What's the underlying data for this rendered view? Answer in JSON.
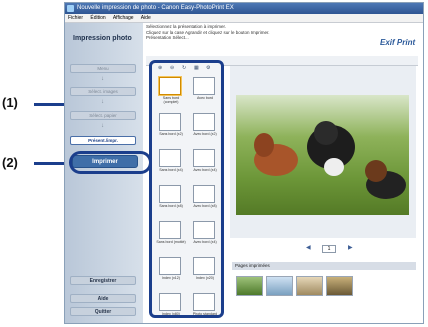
{
  "window": {
    "title": "Nouvelle impression de photo - Canon Easy-PhotoPrint EX",
    "menu": [
      "Fichier",
      "Édition",
      "Affichage",
      "Aide"
    ]
  },
  "sidebar": {
    "heading": "Impression photo",
    "steps": [
      "Menu",
      "Sélect. images",
      "Sélect. papier",
      "Présent./impr."
    ],
    "print_label": "Imprimer",
    "bottom_buttons": [
      "Enregistrer",
      "Aide",
      "Quitter"
    ]
  },
  "main": {
    "instructions": [
      "Sélectionnez la présentation à imprimer.",
      "Cliquez sur la case Agrandir et cliquez sur le bouton Imprimer.",
      "Présentation Sélect..."
    ],
    "brand": "Exif Print"
  },
  "layouts": [
    {
      "label": "Sans bord (complet)"
    },
    {
      "label": "Avec bord"
    },
    {
      "label": "Sans bord (x2)"
    },
    {
      "label": "Avec bord (x2)"
    },
    {
      "label": "Sans bord (x4)"
    },
    {
      "label": "Avec bord (x4)"
    },
    {
      "label": "Sans bord (x8)"
    },
    {
      "label": "Avec bord (x8)"
    },
    {
      "label": "Sans bord (moitié)"
    },
    {
      "label": "Avec bord (x4)"
    },
    {
      "label": "Index (x12)"
    },
    {
      "label": "Index (x20)"
    },
    {
      "label": "Index (x80)"
    },
    {
      "label": "Photo standard (x1 cd)"
    }
  ],
  "preview": {
    "page": "1"
  },
  "strip": {
    "title": "Pages imprimées",
    "thumbs_count": 4
  },
  "callouts": [
    "(1)",
    "(2)"
  ]
}
